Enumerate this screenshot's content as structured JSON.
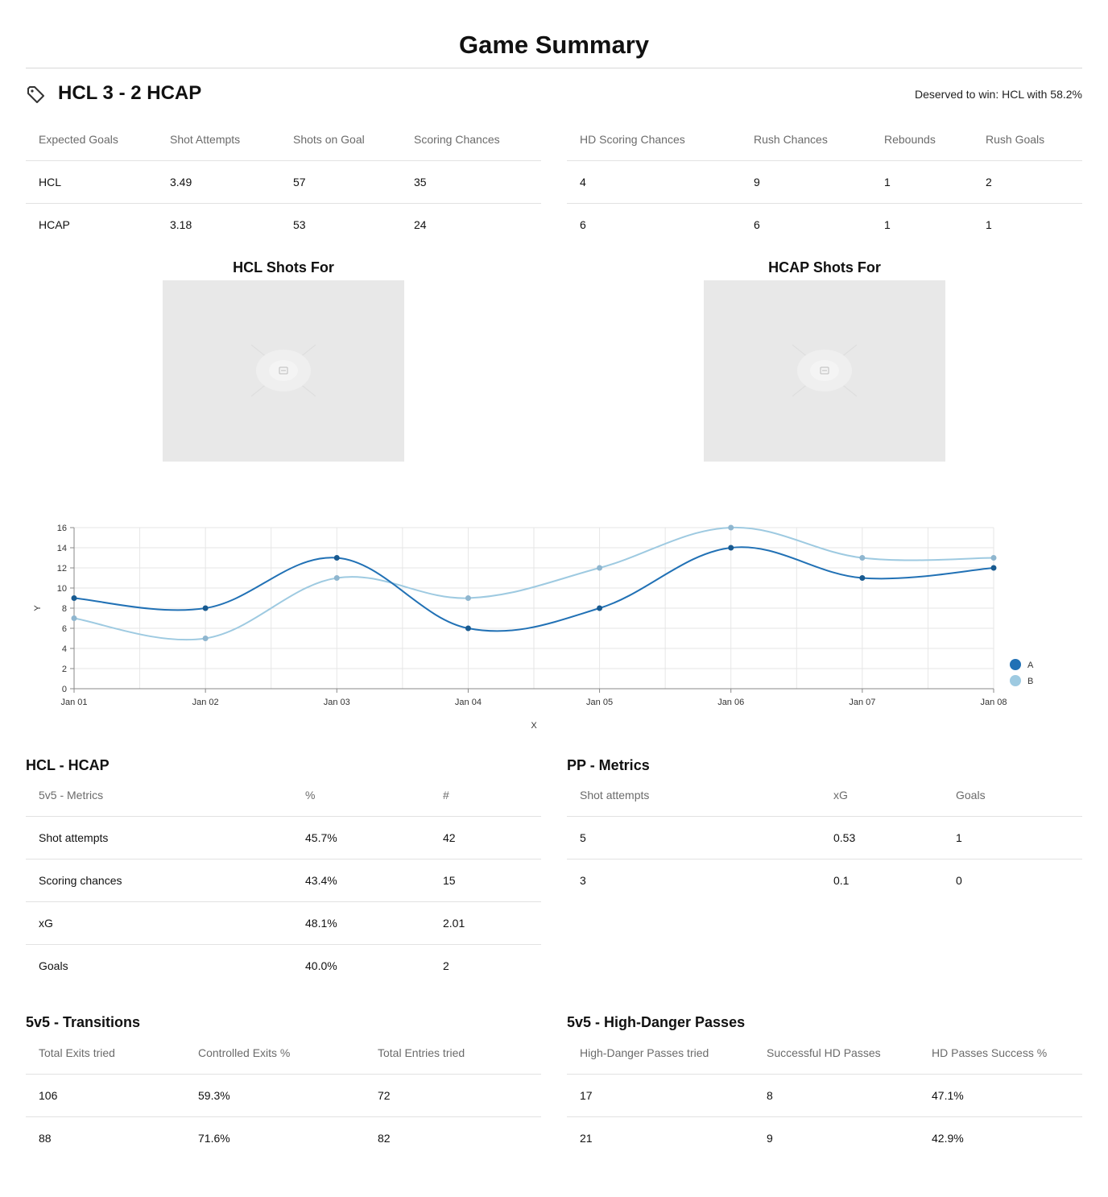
{
  "page_title": "Game Summary",
  "score_line": "HCL 3 - 2 HCAP",
  "deserved": "Deserved to win: HCL with 58.2%",
  "overview_left": {
    "headers": [
      "Expected Goals",
      "Shot Attempts",
      "Shots on Goal",
      "Scoring Chances"
    ],
    "rows": [
      [
        "HCL",
        "3.49",
        "57",
        "35"
      ],
      [
        "HCAP",
        "3.18",
        "53",
        "24"
      ]
    ]
  },
  "overview_right": {
    "headers": [
      "HD Scoring Chances",
      "Rush Chances",
      "Rebounds",
      "Rush Goals"
    ],
    "rows": [
      [
        "4",
        "9",
        "1",
        "2"
      ],
      [
        "6",
        "6",
        "1",
        "1"
      ]
    ]
  },
  "shot_maps": [
    {
      "title": "HCL Shots For",
      "icon": "broken-image-icon"
    },
    {
      "title": "HCAP Shots For",
      "icon": "broken-image-icon"
    }
  ],
  "chart_data": {
    "type": "line",
    "x": [
      "Jan 01",
      "Jan 02",
      "Jan 03",
      "Jan 04",
      "Jan 05",
      "Jan 06",
      "Jan 07",
      "Jan 08"
    ],
    "series": [
      {
        "name": "A",
        "values": [
          9,
          8,
          13,
          6,
          8,
          14,
          11,
          12
        ],
        "color": "#2171b5"
      },
      {
        "name": "B",
        "values": [
          7,
          5,
          11,
          9,
          12,
          16,
          13,
          13
        ],
        "color": "#9ecae1"
      }
    ],
    "xlabel": "X",
    "ylabel": "Y",
    "ylim": [
      0,
      16
    ],
    "yticks": [
      "0",
      "2",
      "4",
      "6",
      "8",
      "10",
      "12",
      "14",
      "16"
    ],
    "grid": true,
    "legend": "bottom-right"
  },
  "metrics_5v5": {
    "title": "HCL - HCAP",
    "headers": [
      "5v5 - Metrics",
      "%",
      "#"
    ],
    "rows": [
      [
        "Shot attempts",
        "45.7%",
        "42"
      ],
      [
        "Scoring chances",
        "43.4%",
        "15"
      ],
      [
        "xG",
        "48.1%",
        "2.01"
      ],
      [
        "Goals",
        "40.0%",
        "2"
      ]
    ]
  },
  "metrics_pp": {
    "title": "PP - Metrics",
    "headers": [
      "Shot attempts",
      "xG",
      "Goals"
    ],
    "rows": [
      [
        "5",
        "0.53",
        "1"
      ],
      [
        "3",
        "0.1",
        "0"
      ]
    ]
  },
  "transitions": {
    "title": "5v5 - Transitions",
    "headers": [
      "Total Exits tried",
      "Controlled Exits %",
      "Total Entries tried"
    ],
    "rows": [
      [
        "106",
        "59.3%",
        "72"
      ],
      [
        "88",
        "71.6%",
        "82"
      ]
    ]
  },
  "hd_passes": {
    "title": "5v5 - High-Danger Passes",
    "headers": [
      "High-Danger Passes tried",
      "Successful HD Passes",
      "HD Passes Success %"
    ],
    "rows": [
      [
        "17",
        "8",
        "47.1%"
      ],
      [
        "21",
        "9",
        "42.9%"
      ]
    ]
  },
  "colors": {
    "series_a": "#2171b5",
    "series_b": "#9ecae1",
    "rink_bg": "#e8e8e8"
  }
}
